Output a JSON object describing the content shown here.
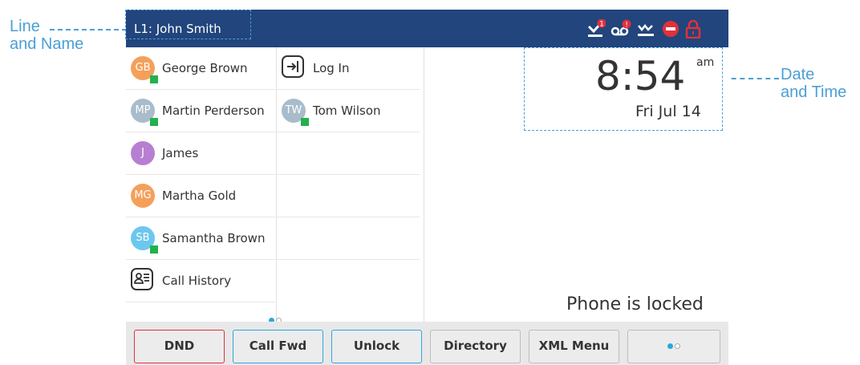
{
  "callouts": {
    "line_name_1": "Line",
    "line_name_2": "and Name",
    "date_time_1": "Date",
    "date_time_2": "and Time"
  },
  "topbar": {
    "line_label": "L1: John Smith",
    "icons": [
      "missed-call-icon",
      "voicemail-icon",
      "call-forward-icon",
      "dnd-icon",
      "lock-icon"
    ],
    "missed_badge": "1",
    "voicemail_badge": "!"
  },
  "colors": {
    "topbar_bg": "#21457c",
    "accent_blue": "#4a9fd6",
    "presence_green": "#22b14c",
    "dnd_red": "#e0313b"
  },
  "contacts_left": [
    {
      "initials": "GB",
      "name": "George Brown",
      "color": "#f5a05a",
      "presence": true
    },
    {
      "initials": "MP",
      "name": "Martin Perderson",
      "color": "#a9bccb",
      "presence": true
    },
    {
      "initials": "J",
      "name": "James",
      "color": "#b77fd1",
      "presence": false
    },
    {
      "initials": "MG",
      "name": "Martha Gold",
      "color": "#f5a05a",
      "presence": false
    },
    {
      "initials": "SB",
      "name": "Samantha Brown",
      "color": "#6cc7ef",
      "presence": true
    }
  ],
  "call_history_label": "Call History",
  "contacts_right": [
    {
      "label": "Log In"
    },
    {
      "initials": "TW",
      "name": "Tom Wilson",
      "color": "#a9bccb",
      "presence": true
    }
  ],
  "clock": {
    "time": "8:54",
    "ampm": "am",
    "date": "Fri Jul 14"
  },
  "status_message": "Phone is locked",
  "softkeys": [
    "DND",
    "Call Fwd",
    "Unlock",
    "Directory",
    "XML Menu"
  ]
}
